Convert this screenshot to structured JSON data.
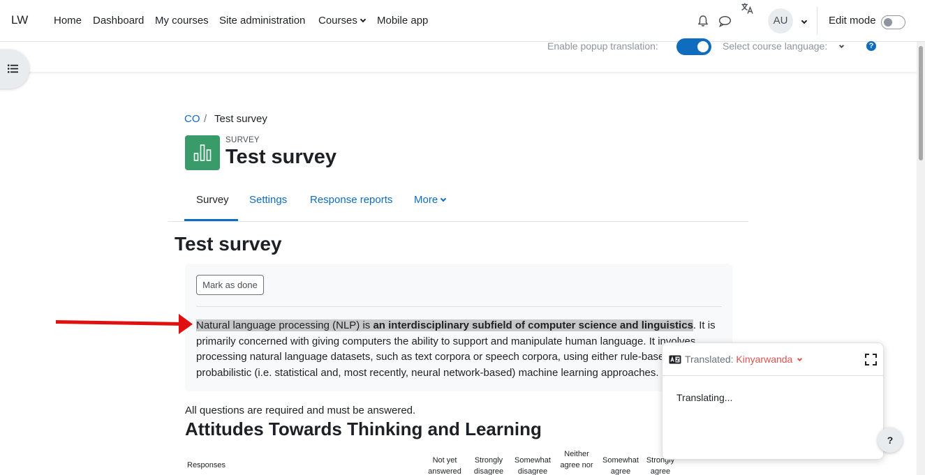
{
  "navbar": {
    "brand": "LW",
    "links": [
      "Home",
      "Dashboard",
      "My courses",
      "Site administration",
      "Courses",
      "Mobile app"
    ],
    "user_initials": "AU",
    "edit_mode_label": "Edit mode",
    "edit_mode_on": false
  },
  "translation_bar": {
    "popup_label": "Enable popup translation:",
    "popup_enabled": true,
    "course_language_label": "Select course language:"
  },
  "breadcrumb": {
    "items": [
      "CO",
      "Test survey"
    ],
    "separator": "/"
  },
  "header": {
    "pre_title": "SURVEY",
    "title": "Test survey"
  },
  "tabs": [
    {
      "label": "Survey",
      "active": true
    },
    {
      "label": "Settings",
      "active": false
    },
    {
      "label": "Response reports",
      "active": false
    },
    {
      "label": "More",
      "active": false
    }
  ],
  "main": {
    "heading": "Test survey",
    "mark_done_label": "Mark as done",
    "intro": {
      "part1": "Natural language processing (NLP) is ",
      "part2_bold": "an interdisciplinary subfield of computer science and linguistics",
      "part3": ". It is primarily concerned with giving computers the ability to support and manipulate human language. It involves processing natural language datasets, such as text corpora or speech corpora, using either rule-based or probabilistic (i.e. statistical and, most recently, neural network-based) machine learning approaches."
    },
    "requirement_note": "All questions are required and must be answered.",
    "section_title": "Attitudes Towards Thinking and Learning",
    "table_headers": {
      "responses": "Responses",
      "not_yet": "Not yet answered",
      "strongly_disagree": "Strongly disagree",
      "somewhat_disagree": "Somewhat disagree",
      "neither": "Neither agree nor",
      "somewhat_agree": "Somewhat agree",
      "strongly_agree": "Strongly agree"
    }
  },
  "translate_popup": {
    "label": "Translated:",
    "language": "Kinyarwanda",
    "status": "Translating..."
  },
  "help_button": "?",
  "colors": {
    "link": "#0f6cbf",
    "activity_icon": "#399b6a",
    "highlight": "#c7c7c7",
    "arrow": "#e01010",
    "popup_language": "#d9534f"
  }
}
